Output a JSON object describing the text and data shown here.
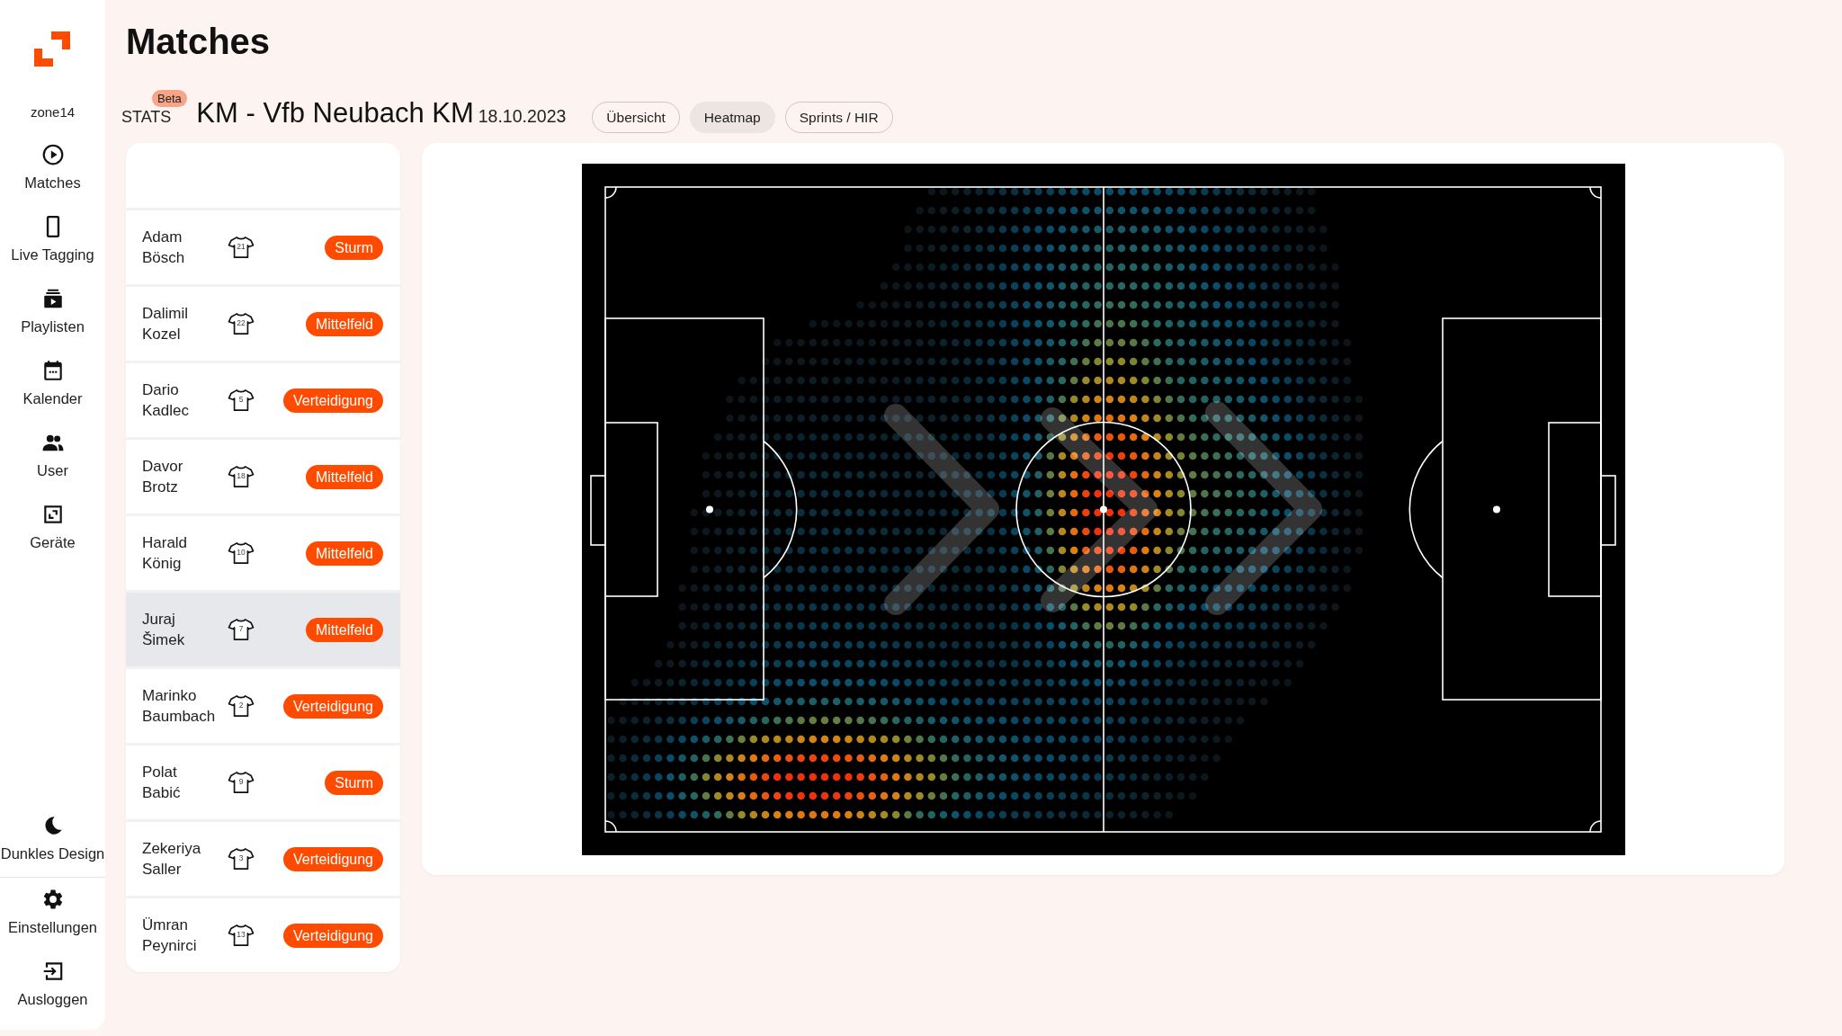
{
  "sidebar": {
    "brand": "zone14",
    "nav_items": [
      {
        "label": "Matches"
      },
      {
        "label": "Live Tagging"
      },
      {
        "label": "Playlisten"
      },
      {
        "label": "Kalender"
      },
      {
        "label": "User"
      },
      {
        "label": "Geräte"
      }
    ],
    "bottom_items": [
      {
        "label": "Dunkles Design"
      },
      {
        "label": "Einstellungen"
      },
      {
        "label": "Ausloggen"
      }
    ]
  },
  "header": {
    "title": "Matches"
  },
  "match_bar": {
    "section": "STATS",
    "badge": "Beta",
    "match_title": "KM - Vfb Neubach KM",
    "date": "18.10.2023",
    "tabs": [
      {
        "label": "Übersicht",
        "selected": false
      },
      {
        "label": "Heatmap",
        "selected": true
      },
      {
        "label": "Sprints / HIR",
        "selected": false
      }
    ]
  },
  "players": [
    {
      "name": "Adam Bösch",
      "shirt_number": "21",
      "position": "Sturm",
      "selected": false
    },
    {
      "name": "Dalimil Kozel",
      "shirt_number": "22",
      "position": "Mittelfeld",
      "selected": false
    },
    {
      "name": "Dario Kadlec",
      "shirt_number": "5",
      "position": "Verteidigung",
      "selected": false
    },
    {
      "name": "Davor Brotz",
      "shirt_number": "18",
      "position": "Mittelfeld",
      "selected": false
    },
    {
      "name": "Harald König",
      "shirt_number": "10",
      "position": "Mittelfeld",
      "selected": false
    },
    {
      "name": "Juraj Šimek",
      "shirt_number": "7",
      "position": "Mittelfeld",
      "selected": true
    },
    {
      "name": "Marinko Baumbach",
      "shirt_number": "2",
      "position": "Verteidigung",
      "selected": false
    },
    {
      "name": "Polat Babić",
      "shirt_number": "9",
      "position": "Sturm",
      "selected": false
    },
    {
      "name": "Zekeriya Saller",
      "shirt_number": "3",
      "position": "Verteidigung",
      "selected": false
    },
    {
      "name": "Ümran Peynirci",
      "shirt_number": "13",
      "position": "Verteidigung",
      "selected": false
    }
  ]
}
